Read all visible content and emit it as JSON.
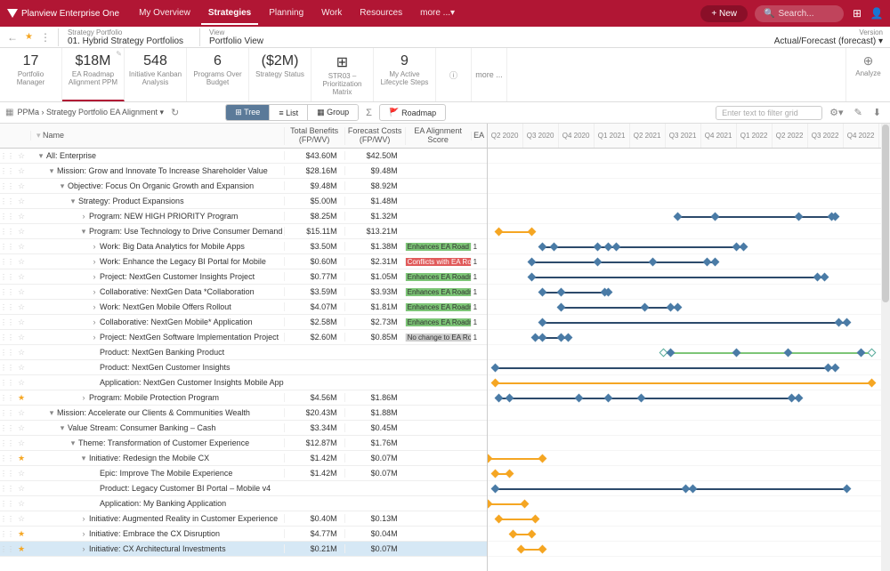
{
  "brand": "Planview Enterprise One",
  "nav": [
    "My Overview",
    "Strategies",
    "Planning",
    "Work",
    "Resources",
    "more ...▾"
  ],
  "nav_active": 1,
  "new_btn": "+ New",
  "search_ph": "Search...",
  "context": {
    "portfolio_label": "Strategy Portfolio",
    "portfolio_value": "01. Hybrid Strategy Portfolios",
    "view_label": "View",
    "view_value": "Portfolio View",
    "version_label": "Version",
    "version_value": "Actual/Forecast (forecast) ▾"
  },
  "kpis": [
    {
      "val": "17",
      "lbl": "Portfolio Manager"
    },
    {
      "val": "$18M",
      "lbl": "EA Roadmap Alignment PPM"
    },
    {
      "val": "548",
      "lbl": "Initiative Kanban Analysis"
    },
    {
      "val": "6",
      "lbl": "Programs Over Budget"
    },
    {
      "val": "($2M)",
      "lbl": "Strategy Status"
    },
    {
      "val": "",
      "lbl": "STR03 – Prioritization Matrix",
      "icon": "⊞"
    },
    {
      "val": "9",
      "lbl": "My Active Lifecycle Steps"
    }
  ],
  "kpi_active": 1,
  "kpi_more": "more ...",
  "kpi_info": "ⓘ",
  "analyze": "Analyze",
  "toolbar": {
    "crumb_pre": "PPMa › Strategy Portfolio EA Alignment ▾",
    "views": [
      "Tree",
      "List",
      "Group"
    ],
    "view_active": 0,
    "roadmap": "Roadmap",
    "filter_ph": "Enter text to filter grid"
  },
  "cols": {
    "name": "Name",
    "benefits": "Total Benefits (FP/WV)",
    "forecast": "Forecast Costs (FP/WV)",
    "ea": "EA Alignment Score",
    "ea2": "EA"
  },
  "timeline_cols": [
    "Q2 2020",
    "Q3 2020",
    "Q4 2020",
    "Q1 2021",
    "Q2 2021",
    "Q3 2021",
    "Q4 2021",
    "Q1 2022",
    "Q2 2022",
    "Q3 2022",
    "Q4 2022"
  ],
  "rows": [
    {
      "i": 0,
      "star": 0,
      "name": "All: Enterprise",
      "b": "$43.60M",
      "f": "$42.50M",
      "ea": "",
      "exp": "▾"
    },
    {
      "i": 1,
      "star": 0,
      "name": "Mission: Grow and Innovate To Increase Shareholder Value",
      "b": "$28.16M",
      "f": "$9.48M",
      "ea": "",
      "exp": "▾"
    },
    {
      "i": 2,
      "star": 0,
      "name": "Objective: Focus On Organic Growth and Expansion",
      "b": "$9.48M",
      "f": "$8.92M",
      "ea": "",
      "exp": "▾"
    },
    {
      "i": 3,
      "star": 0,
      "name": "Strategy: Product Expansions",
      "b": "$5.00M",
      "f": "$1.48M",
      "ea": "",
      "exp": "▾"
    },
    {
      "i": 4,
      "star": 0,
      "name": "Program: NEW HIGH PRIORITY Program",
      "b": "$8.25M",
      "f": "$1.32M",
      "ea": "",
      "exp": "›"
    },
    {
      "i": 4,
      "star": 0,
      "name": "Program: Use Technology to Drive Consumer Demand",
      "b": "$15.11M",
      "f": "$13.21M",
      "ea": "",
      "exp": "▾"
    },
    {
      "i": 5,
      "star": 0,
      "name": "Work: Big Data Analytics for Mobile Apps",
      "b": "$3.50M",
      "f": "$1.38M",
      "ea": "Enhances EA Road",
      "eac": "ea-enh",
      "exp": "›"
    },
    {
      "i": 5,
      "star": 0,
      "name": "Work: Enhance the Legacy BI Portal for Mobile",
      "b": "$0.60M",
      "f": "$2.31M",
      "ea": "Conflicts with EA Ro",
      "eac": "ea-con",
      "exp": "›"
    },
    {
      "i": 5,
      "star": 0,
      "name": "Project: NextGen Customer Insights Project",
      "b": "$0.77M",
      "f": "$1.05M",
      "ea": "Enhances EA Roadm",
      "eac": "ea-enh",
      "exp": "›"
    },
    {
      "i": 5,
      "star": 0,
      "name": "Collaborative: NextGen Data *Collaboration",
      "b": "$3.59M",
      "f": "$3.93M",
      "ea": "Enhances EA Roadm",
      "eac": "ea-enh",
      "exp": "›"
    },
    {
      "i": 5,
      "star": 0,
      "name": "Work: NextGen Mobile Offers Rollout",
      "b": "$4.07M",
      "f": "$1.81M",
      "ea": "Enhances EA Roadm",
      "eac": "ea-enh",
      "exp": "›"
    },
    {
      "i": 5,
      "star": 0,
      "name": "Collaborative: NextGen Mobile* Application",
      "b": "$2.58M",
      "f": "$2.73M",
      "ea": "Enhances EA Roadm",
      "eac": "ea-enh",
      "exp": "›"
    },
    {
      "i": 5,
      "star": 0,
      "name": "Project: NextGen Software Implementation Project",
      "b": "$2.60M",
      "f": "$0.85M",
      "ea": "No change to EA Ro",
      "eac": "ea-no",
      "exp": "›"
    },
    {
      "i": 5,
      "star": 0,
      "name": "Product: NextGen Banking Product",
      "b": "",
      "f": "",
      "ea": ""
    },
    {
      "i": 5,
      "star": 0,
      "name": "Product: NextGen Customer Insights",
      "b": "",
      "f": "",
      "ea": ""
    },
    {
      "i": 5,
      "star": 0,
      "name": "Application: NextGen Customer Insights Mobile App",
      "b": "",
      "f": "",
      "ea": ""
    },
    {
      "i": 4,
      "star": 1,
      "name": "Program: Mobile Protection Program",
      "b": "$4.56M",
      "f": "$1.86M",
      "ea": "",
      "exp": "›"
    },
    {
      "i": 1,
      "star": 0,
      "name": "Mission: Accelerate our Clients & Communities Wealth",
      "b": "$20.43M",
      "f": "$1.88M",
      "ea": "",
      "exp": "▾"
    },
    {
      "i": 2,
      "star": 0,
      "name": "Value Stream: Consumer Banking – Cash",
      "b": "$3.34M",
      "f": "$0.45M",
      "ea": "",
      "exp": "▾"
    },
    {
      "i": 3,
      "star": 0,
      "name": "Theme: Transformation of Customer Experience",
      "b": "$12.87M",
      "f": "$1.76M",
      "ea": "",
      "exp": "▾"
    },
    {
      "i": 4,
      "star": 1,
      "name": "Initiative: Redesign the Mobile CX",
      "b": "$1.42M",
      "f": "$0.07M",
      "ea": "",
      "exp": "▾"
    },
    {
      "i": 5,
      "star": 0,
      "name": "Epic: Improve The Mobile Experience",
      "b": "$1.42M",
      "f": "$0.07M",
      "ea": ""
    },
    {
      "i": 5,
      "star": 0,
      "name": "Product: Legacy Customer BI Portal – Mobile v4",
      "b": "",
      "f": "",
      "ea": ""
    },
    {
      "i": 5,
      "star": 0,
      "name": "Application: My Banking Application",
      "b": "",
      "f": "",
      "ea": ""
    },
    {
      "i": 4,
      "star": 0,
      "name": "Initiative: Augmented Reality in Customer Experience",
      "b": "$0.40M",
      "f": "$0.13M",
      "ea": "",
      "exp": "›"
    },
    {
      "i": 4,
      "star": 1,
      "name": "Initiative: Embrace the CX Disruption",
      "b": "$4.77M",
      "f": "$0.04M",
      "ea": "",
      "exp": "›"
    },
    {
      "i": 4,
      "star": 1,
      "name": "Initiative: CX Architectural Investments",
      "b": "$0.21M",
      "f": "$0.07M",
      "ea": "",
      "exp": "›",
      "sel": true
    }
  ],
  "chart_data": {
    "type": "gantt",
    "x_unit": "quarter",
    "x_range": [
      "Q2 2020",
      "Q4 2022"
    ],
    "bars": [
      {
        "row": 4,
        "start": 5.2,
        "end": 9.5,
        "color": "navy",
        "milestones": [
          6.2,
          8.5,
          9.4
        ]
      },
      {
        "row": 5,
        "start": 0.3,
        "end": 1.2,
        "color": "orange"
      },
      {
        "row": 6,
        "start": 1.5,
        "end": 7.0,
        "color": "navy",
        "milestones": [
          1.8,
          3.0,
          3.3,
          3.5,
          6.8
        ]
      },
      {
        "row": 7,
        "start": 1.2,
        "end": 6.2,
        "color": "navy",
        "milestones": [
          3.0,
          4.5,
          6.0
        ]
      },
      {
        "row": 8,
        "start": 1.2,
        "end": 9.2,
        "color": "navy",
        "milestones": [
          9.0
        ]
      },
      {
        "row": 9,
        "start": 1.5,
        "end": 3.3,
        "color": "navy",
        "milestones": [
          2.0,
          3.2
        ]
      },
      {
        "row": 10,
        "start": 2.0,
        "end": 5.2,
        "color": "navy",
        "milestones": [
          4.3,
          5.0
        ]
      },
      {
        "row": 11,
        "start": 1.5,
        "end": 9.8,
        "color": "navy",
        "milestones": [
          9.6
        ]
      },
      {
        "row": 12,
        "start": 1.3,
        "end": 2.2,
        "color": "navy",
        "milestones": [
          1.5,
          2.0
        ]
      },
      {
        "row": 13,
        "start": 4.8,
        "end": 10.5,
        "color": "green",
        "milestones": [
          5.0,
          6.8,
          8.2,
          10.2
        ]
      },
      {
        "row": 14,
        "start": 0.2,
        "end": 9.5,
        "color": "navy",
        "milestones": [
          9.3
        ]
      },
      {
        "row": 15,
        "start": 0.2,
        "end": 10.5,
        "color": "orange"
      },
      {
        "row": 16,
        "start": 0.3,
        "end": 8.5,
        "color": "navy",
        "milestones": [
          0.6,
          2.5,
          3.3,
          4.2,
          8.3
        ]
      },
      {
        "row": 20,
        "start": 0.0,
        "end": 1.5,
        "color": "orange"
      },
      {
        "row": 21,
        "start": 0.2,
        "end": 0.6,
        "color": "orange"
      },
      {
        "row": 22,
        "start": 0.2,
        "end": 9.8,
        "color": "navy",
        "milestones": [
          5.4,
          5.6
        ]
      },
      {
        "row": 23,
        "start": 0.0,
        "end": 1.0,
        "color": "orange"
      },
      {
        "row": 24,
        "start": 0.3,
        "end": 1.3,
        "color": "orange"
      },
      {
        "row": 25,
        "start": 0.7,
        "end": 1.2,
        "color": "orange"
      },
      {
        "row": 26,
        "start": 0.9,
        "end": 1.5,
        "color": "orange"
      }
    ]
  }
}
